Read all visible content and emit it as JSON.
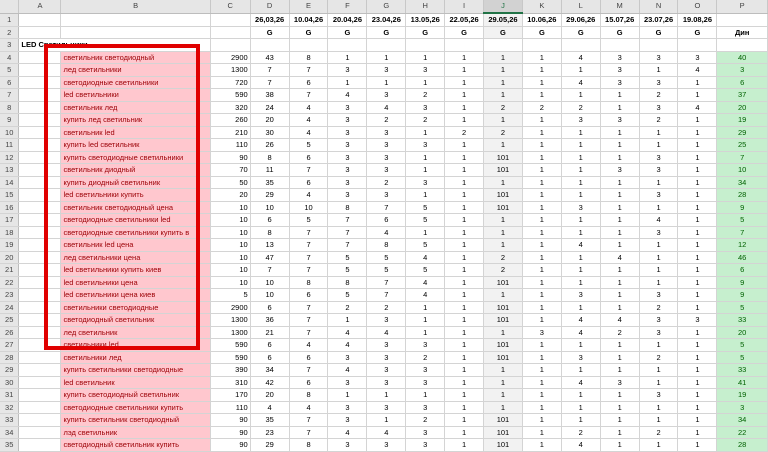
{
  "columns": [
    "",
    "A",
    "B",
    "C",
    "D",
    "E",
    "F",
    "G",
    "H",
    "I",
    "J",
    "K",
    "L",
    "M",
    "N",
    "O",
    "P"
  ],
  "selected_column": "J",
  "dates": [
    "26,03,26",
    "10.04,26",
    "20.04,26",
    "23.04,26",
    "13.05,26",
    "22.05,26",
    "29.05,26",
    "10.06,26",
    "29.06,26",
    "15.07,26",
    "23.07,26",
    "19.08,26"
  ],
  "g_label": "G",
  "din_label": "Дин",
  "section_title": "LED Светильники",
  "rows": [
    {
      "n": "4",
      "kw": "светильник светодиодный",
      "c": "2900",
      "v": [
        "43",
        "8",
        "1",
        "1",
        "1",
        "1",
        "1",
        "1",
        "4",
        "3",
        "3",
        "3"
      ],
      "p": "40"
    },
    {
      "n": "5",
      "kw": "лед светильники",
      "c": "1300",
      "v": [
        "7",
        "7",
        "3",
        "3",
        "3",
        "1",
        "1",
        "1",
        "1",
        "3",
        "1",
        "4"
      ],
      "p": "3"
    },
    {
      "n": "6",
      "kw": "светодиодные светильники",
      "c": "720",
      "v": [
        "7",
        "6",
        "1",
        "1",
        "1",
        "1",
        "1",
        "1",
        "4",
        "3",
        "3",
        "1"
      ],
      "p": "6"
    },
    {
      "n": "7",
      "kw": "led светильники",
      "c": "590",
      "v": [
        "38",
        "7",
        "4",
        "3",
        "2",
        "1",
        "1",
        "1",
        "1",
        "1",
        "2",
        "1"
      ],
      "p": "37"
    },
    {
      "n": "8",
      "kw": "светильник лед",
      "c": "320",
      "v": [
        "24",
        "4",
        "3",
        "4",
        "3",
        "1",
        "2",
        "2",
        "2",
        "1",
        "3",
        "4"
      ],
      "p": "20"
    },
    {
      "n": "9",
      "kw": "купить лед светильник",
      "c": "260",
      "v": [
        "20",
        "4",
        "3",
        "2",
        "2",
        "1",
        "1",
        "1",
        "3",
        "3",
        "2",
        "1"
      ],
      "p": "19"
    },
    {
      "n": "10",
      "kw": "светильник led",
      "c": "210",
      "v": [
        "30",
        "4",
        "3",
        "3",
        "1",
        "2",
        "2",
        "1",
        "1",
        "1",
        "1",
        "1"
      ],
      "p": "29"
    },
    {
      "n": "11",
      "kw": "купить led светильник",
      "c": "110",
      "v": [
        "26",
        "5",
        "3",
        "3",
        "3",
        "1",
        "1",
        "1",
        "1",
        "1",
        "1",
        "1"
      ],
      "p": "25"
    },
    {
      "n": "12",
      "kw": "купить светодиодные светильники",
      "c": "90",
      "v": [
        "8",
        "6",
        "3",
        "3",
        "1",
        "1",
        "101",
        "1",
        "1",
        "1",
        "3",
        "1"
      ],
      "p": "7"
    },
    {
      "n": "13",
      "kw": "светильник диодный",
      "c": "70",
      "v": [
        "11",
        "7",
        "3",
        "3",
        "1",
        "1",
        "101",
        "1",
        "1",
        "3",
        "3",
        "1"
      ],
      "p": "10"
    },
    {
      "n": "14",
      "kw": "купить диодный светильник",
      "c": "50",
      "v": [
        "35",
        "6",
        "3",
        "2",
        "3",
        "1",
        "1",
        "1",
        "1",
        "1",
        "1",
        "1"
      ],
      "p": "34"
    },
    {
      "n": "15",
      "kw": "led светильники купить",
      "c": "20",
      "v": [
        "29",
        "4",
        "3",
        "3",
        "1",
        "1",
        "101",
        "1",
        "1",
        "1",
        "3",
        "1"
      ],
      "p": "28"
    },
    {
      "n": "16",
      "kw": "светильник светодиодный цена",
      "c": "10",
      "v": [
        "10",
        "10",
        "8",
        "7",
        "5",
        "1",
        "101",
        "1",
        "3",
        "1",
        "1",
        "1"
      ],
      "p": "9"
    },
    {
      "n": "17",
      "kw": "светодиодные светильники led",
      "c": "10",
      "v": [
        "6",
        "5",
        "7",
        "6",
        "5",
        "1",
        "1",
        "1",
        "1",
        "1",
        "4",
        "1"
      ],
      "p": "5"
    },
    {
      "n": "18",
      "kw": "светодиодные светильники купить в",
      "c": "10",
      "v": [
        "8",
        "7",
        "7",
        "4",
        "1",
        "1",
        "1",
        "1",
        "1",
        "1",
        "3",
        "1"
      ],
      "p": "7"
    },
    {
      "n": "19",
      "kw": "светильник led цена",
      "c": "10",
      "v": [
        "13",
        "7",
        "7",
        "8",
        "5",
        "1",
        "1",
        "1",
        "4",
        "1",
        "1",
        "1"
      ],
      "p": "12"
    },
    {
      "n": "20",
      "kw": "лед светильники цена",
      "c": "10",
      "v": [
        "47",
        "7",
        "5",
        "5",
        "4",
        "1",
        "2",
        "1",
        "1",
        "4",
        "1",
        "1"
      ],
      "p": "46"
    },
    {
      "n": "21",
      "kw": "led светильники купить киев",
      "c": "10",
      "v": [
        "7",
        "7",
        "5",
        "5",
        "5",
        "1",
        "2",
        "1",
        "1",
        "1",
        "1",
        "1"
      ],
      "p": "6"
    },
    {
      "n": "22",
      "kw": "led светильники цена",
      "c": "10",
      "v": [
        "10",
        "8",
        "8",
        "7",
        "4",
        "1",
        "101",
        "1",
        "1",
        "1",
        "1",
        "1"
      ],
      "p": "9"
    },
    {
      "n": "23",
      "kw": "led светильники цена киев",
      "c": "5",
      "v": [
        "10",
        "6",
        "5",
        "7",
        "4",
        "1",
        "1",
        "1",
        "3",
        "1",
        "3",
        "1"
      ],
      "p": "9"
    },
    {
      "n": "24",
      "kw": "светильники светодиодные",
      "c": "2900",
      "v": [
        "6",
        "7",
        "2",
        "2",
        "1",
        "1",
        "101",
        "1",
        "1",
        "1",
        "2",
        "1"
      ],
      "p": "5"
    },
    {
      "n": "25",
      "kw": "светодиодный светильник",
      "c": "1300",
      "v": [
        "36",
        "7",
        "1",
        "3",
        "1",
        "1",
        "101",
        "1",
        "4",
        "4",
        "3",
        "3"
      ],
      "p": "33"
    },
    {
      "n": "26",
      "kw": "лед светильник",
      "c": "1300",
      "v": [
        "21",
        "7",
        "4",
        "4",
        "1",
        "1",
        "1",
        "3",
        "4",
        "2",
        "3",
        "1"
      ],
      "p": "20"
    },
    {
      "n": "27",
      "kw": "светильники led",
      "c": "590",
      "v": [
        "6",
        "4",
        "4",
        "3",
        "3",
        "1",
        "101",
        "1",
        "1",
        "1",
        "1",
        "1"
      ],
      "p": "5"
    },
    {
      "n": "28",
      "kw": "светильники лед",
      "c": "590",
      "v": [
        "6",
        "6",
        "3",
        "3",
        "2",
        "1",
        "101",
        "1",
        "3",
        "1",
        "2",
        "1"
      ],
      "p": "5"
    },
    {
      "n": "29",
      "kw": "купить светильники светодиодные",
      "c": "390",
      "v": [
        "34",
        "7",
        "4",
        "3",
        "3",
        "1",
        "1",
        "1",
        "1",
        "1",
        "1",
        "1"
      ],
      "p": "33"
    },
    {
      "n": "30",
      "kw": "led светильник",
      "c": "310",
      "v": [
        "42",
        "6",
        "3",
        "3",
        "3",
        "1",
        "1",
        "1",
        "4",
        "3",
        "1",
        "1"
      ],
      "p": "41"
    },
    {
      "n": "31",
      "kw": "купить светодиодный светильник",
      "c": "170",
      "v": [
        "20",
        "8",
        "1",
        "1",
        "1",
        "1",
        "1",
        "1",
        "1",
        "1",
        "3",
        "1"
      ],
      "p": "19"
    },
    {
      "n": "32",
      "kw": "светодиодные светильники купить",
      "c": "110",
      "v": [
        "4",
        "4",
        "3",
        "3",
        "3",
        "1",
        "1",
        "1",
        "1",
        "1",
        "1",
        "1"
      ],
      "p": "3"
    },
    {
      "n": "33",
      "kw": "купить светильник светодиодный",
      "c": "90",
      "v": [
        "35",
        "7",
        "3",
        "1",
        "2",
        "1",
        "101",
        "1",
        "1",
        "1",
        "1",
        "1"
      ],
      "p": "34"
    },
    {
      "n": "34",
      "kw": "лэд светильник",
      "c": "90",
      "v": [
        "23",
        "7",
        "4",
        "4",
        "3",
        "1",
        "101",
        "1",
        "2",
        "1",
        "2",
        "1"
      ],
      "p": "22"
    },
    {
      "n": "35",
      "kw": "светодиодный светильник купить",
      "c": "90",
      "v": [
        "29",
        "8",
        "3",
        "3",
        "3",
        "1",
        "101",
        "1",
        "4",
        "1",
        "1",
        "1"
      ],
      "p": "28"
    }
  ]
}
